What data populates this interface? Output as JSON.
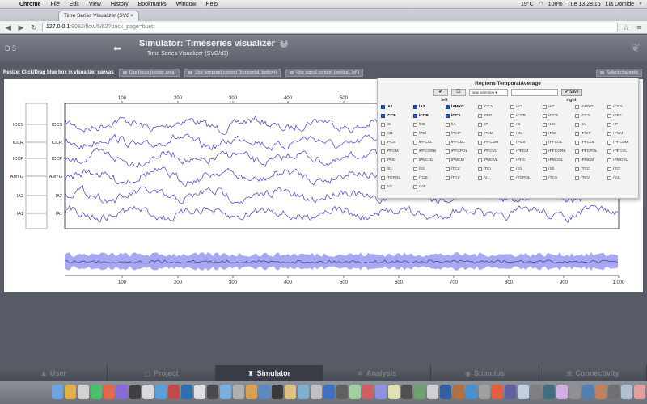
{
  "menubar": {
    "app": "Chrome",
    "items": [
      "File",
      "Edit",
      "View",
      "History",
      "Bookmarks",
      "Window",
      "Help"
    ],
    "battery": "100%",
    "temperature": "19°C",
    "clock": "Tue 13:28:16",
    "user": "Lia Domide"
  },
  "browser": {
    "tab_title": "Time Series Visualizer (SVG/d3)",
    "url_host": "127.0.0.1",
    "url_path": ":8082/flow/5/62?back_page=burst"
  },
  "header": {
    "project_id": "D 5",
    "title": "Simulator: Timeseries visualizer",
    "subtitle": "Time Series Visualizer (SVG/d3)"
  },
  "resize": {
    "label": "Resize: Click/Drag blue box in visualizer canvas",
    "btn_focus": "Use focus (center area)",
    "btn_temporal": "Use temporal context (horizontal, bottom)",
    "btn_signal": "Use signal context (vertical, left)",
    "btn_select": "Select channels"
  },
  "regions": {
    "title": "Regions TemporalAverage",
    "selection": "New selection",
    "save": "Save",
    "left_label": "left",
    "right_label": "right",
    "items": [
      {
        "n": "lA1",
        "on": true
      },
      {
        "n": "lA2",
        "on": true
      },
      {
        "n": "lAMYG",
        "on": true
      },
      {
        "n": "lCCA",
        "on": false
      },
      {
        "n": "rA1",
        "on": false
      },
      {
        "n": "rA2",
        "on": false
      },
      {
        "n": "rAMYG",
        "on": false
      },
      {
        "n": "rCCA",
        "on": false
      },
      {
        "n": "lCCP",
        "on": true
      },
      {
        "n": "lCCR",
        "on": true
      },
      {
        "n": "lCCS",
        "on": true
      },
      {
        "n": "lFEF",
        "on": false
      },
      {
        "n": "rCCP",
        "on": false
      },
      {
        "n": "rCCR",
        "on": false
      },
      {
        "n": "rCCS",
        "on": false
      },
      {
        "n": "rFEF",
        "on": false
      },
      {
        "n": "lG",
        "on": false
      },
      {
        "n": "lHC",
        "on": false
      },
      {
        "n": "lIA",
        "on": false
      },
      {
        "n": "lIP",
        "on": false
      },
      {
        "n": "rG",
        "on": false
      },
      {
        "n": "rHC",
        "on": false
      },
      {
        "n": "rIA",
        "on": false
      },
      {
        "n": "rIP",
        "on": false
      },
      {
        "n": "lM1",
        "on": false
      },
      {
        "n": "lPCI",
        "on": false
      },
      {
        "n": "lPCIP",
        "on": false
      },
      {
        "n": "lPCM",
        "on": false
      },
      {
        "n": "rM1",
        "on": false
      },
      {
        "n": "rPCI",
        "on": false
      },
      {
        "n": "rPCIP",
        "on": false
      },
      {
        "n": "rPCM",
        "on": false
      },
      {
        "n": "lPCS",
        "on": false
      },
      {
        "n": "lPFCCL",
        "on": false
      },
      {
        "n": "lPFCDL",
        "on": false
      },
      {
        "n": "lPFCDM",
        "on": false
      },
      {
        "n": "rPCS",
        "on": false
      },
      {
        "n": "rPFCCL",
        "on": false
      },
      {
        "n": "rPFCDL",
        "on": false
      },
      {
        "n": "rPFCDM",
        "on": false
      },
      {
        "n": "lPFCM",
        "on": false
      },
      {
        "n": "lPFCORB",
        "on": false
      },
      {
        "n": "lPFCPOL",
        "on": false
      },
      {
        "n": "lPFCVL",
        "on": false
      },
      {
        "n": "rPFCM",
        "on": false
      },
      {
        "n": "rPFCORB",
        "on": false
      },
      {
        "n": "rPFCPOL",
        "on": false
      },
      {
        "n": "rPFCVL",
        "on": false
      },
      {
        "n": "lPHC",
        "on": false
      },
      {
        "n": "lPMCDL",
        "on": false
      },
      {
        "n": "lPMCM",
        "on": false
      },
      {
        "n": "lPMCVL",
        "on": false
      },
      {
        "n": "rPHC",
        "on": false
      },
      {
        "n": "rPMCDL",
        "on": false
      },
      {
        "n": "rPMCM",
        "on": false
      },
      {
        "n": "rPMCVL",
        "on": false
      },
      {
        "n": "lS1",
        "on": false
      },
      {
        "n": "lS2",
        "on": false
      },
      {
        "n": "lTCC",
        "on": false
      },
      {
        "n": "lTCI",
        "on": false
      },
      {
        "n": "rS1",
        "on": false
      },
      {
        "n": "rS2",
        "on": false
      },
      {
        "n": "rTCC",
        "on": false
      },
      {
        "n": "rTCI",
        "on": false
      },
      {
        "n": "lTCPOL",
        "on": false
      },
      {
        "n": "lTCS",
        "on": false
      },
      {
        "n": "lTCV",
        "on": false
      },
      {
        "n": "lV1",
        "on": false
      },
      {
        "n": "rTCPOL",
        "on": false
      },
      {
        "n": "rTCS",
        "on": false
      },
      {
        "n": "rTCV",
        "on": false
      },
      {
        "n": "rV1",
        "on": false
      },
      {
        "n": "lV2",
        "on": false
      },
      {
        "n": "rV2",
        "on": false
      }
    ]
  },
  "channels": [
    "lCCS",
    "lCCR",
    "lCCP",
    "lAMYG",
    "lA2",
    "lA1"
  ],
  "axis_ticks": [
    "100",
    "200",
    "300",
    "400",
    "500",
    "600",
    "700",
    "800",
    "900",
    "1,000"
  ],
  "nav": [
    {
      "label": "User",
      "icon": "user-icon",
      "glyph": "♟",
      "active": false
    },
    {
      "label": "Project",
      "icon": "project-icon",
      "glyph": "▢",
      "active": false
    },
    {
      "label": "Simulator",
      "icon": "simulator-icon",
      "glyph": "♜",
      "active": true
    },
    {
      "label": "Analysis",
      "icon": "analysis-icon",
      "glyph": "✲",
      "active": false
    },
    {
      "label": "Stimulus",
      "icon": "stimulus-icon",
      "glyph": "◉",
      "active": false
    },
    {
      "label": "Connectivity",
      "icon": "connectivity-icon",
      "glyph": "⌘",
      "active": false
    }
  ],
  "colors": {
    "signal": "#3a3ad6",
    "band": "#a8a8f0",
    "accent": "#2d5dc8"
  }
}
